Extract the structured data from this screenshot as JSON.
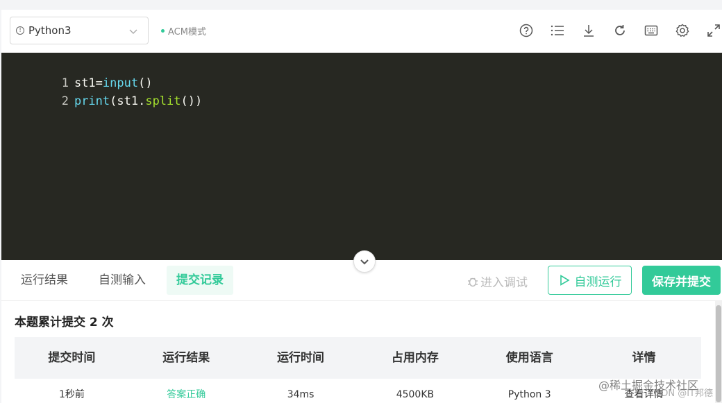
{
  "toolbar": {
    "language": "Python3",
    "mode": "ACM模式",
    "icons": [
      "help-icon",
      "list-icon",
      "download-icon",
      "refresh-icon",
      "keyboard-icon",
      "settings-icon",
      "fullscreen-icon"
    ]
  },
  "editor": {
    "lines": [
      {
        "num": "1",
        "tokens": [
          {
            "t": "st1=",
            "c": "c-def"
          },
          {
            "t": "input",
            "c": "c-fn"
          },
          {
            "t": "()",
            "c": "c-def"
          }
        ]
      },
      {
        "num": "2",
        "tokens": [
          {
            "t": "print",
            "c": "c-fn"
          },
          {
            "t": "(st1.",
            "c": "c-def"
          },
          {
            "t": "split",
            "c": "c-attr"
          },
          {
            "t": "())",
            "c": "c-def"
          }
        ]
      }
    ]
  },
  "tabs": {
    "run_result": "运行结果",
    "self_input": "自测输入",
    "submissions": "提交记录"
  },
  "actions": {
    "debug": "进入调试",
    "self_run": "自测运行",
    "save_submit": "保存并提交"
  },
  "results": {
    "summary": "本题累计提交 2 次",
    "headers": [
      "提交时间",
      "运行结果",
      "运行时间",
      "占用内存",
      "使用语言",
      "详情"
    ],
    "rows": [
      [
        "1秒前",
        "答案正确",
        "34ms",
        "4500KB",
        "Python 3",
        "查看详情"
      ]
    ]
  },
  "watermark": {
    "main": "@稀土掘金技术社区",
    "sub": "CSDN @IT邦德"
  },
  "colors": {
    "accent": "#32ca99",
    "editor_bg": "#272822"
  }
}
